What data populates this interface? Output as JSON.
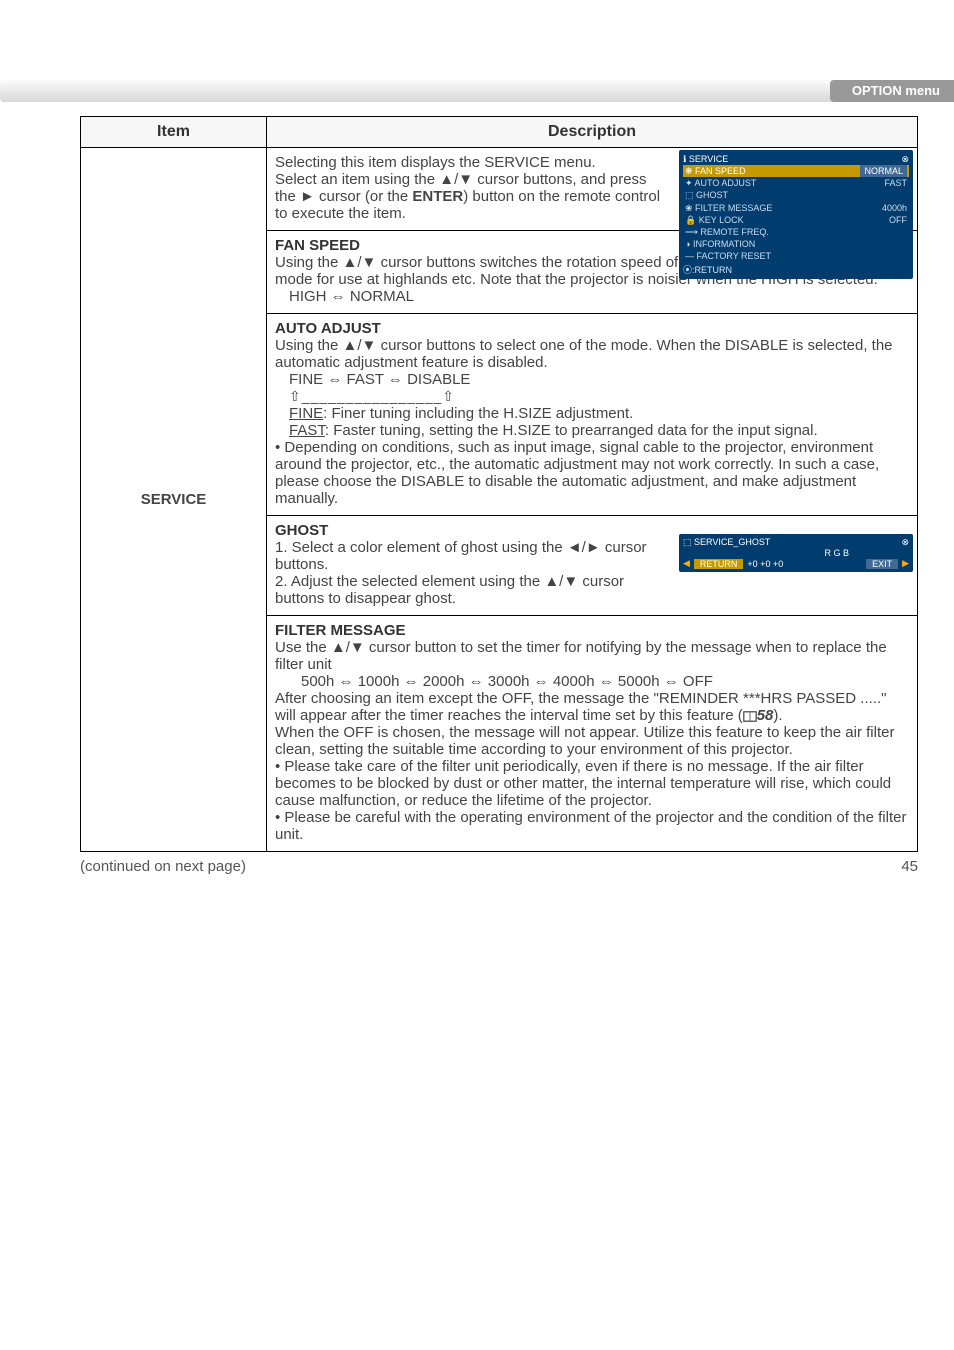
{
  "header": {
    "tab": "OPTION menu"
  },
  "table": {
    "head_item": "Item",
    "head_desc": "Description",
    "item_label": "SERVICE"
  },
  "sec1": {
    "p1": "Selecting this item displays the SERVICE menu.",
    "p2": "Select an item using the ▲/▼ cursor buttons, and press the ► cursor (or the ",
    "p2b": "ENTER",
    "p2c": ") button on the remote control to execute the item."
  },
  "osd": {
    "title": "SERVICE",
    "r1k": "FAN SPEED",
    "r1v": "NORMAL",
    "r2k": "AUTO ADJUST",
    "r2v": "FAST",
    "r3k": "GHOST",
    "r4k": "FILTER MESSAGE",
    "r4v": "4000h",
    "r5k": "KEY LOCK",
    "r5v": "OFF",
    "r6k": "REMOTE FREQ.",
    "r7k": "INFORMATION",
    "r8k": "FACTORY RESET",
    "return": "RETURN"
  },
  "sec2": {
    "h": "FAN SPEED",
    "p1": "Using the ▲/▼ cursor buttons switches the rotation speed of the cooling fans. The HIGH is the mode for use at highlands etc. Note that the projector is noisier when the HIGH is selected.",
    "p2": "HIGH ⇔ NORMAL"
  },
  "sec3": {
    "h": "AUTO ADJUST",
    "p1": "Using the ▲/▼ cursor buttons to select one of the mode. When the DISABLE is selected, the automatic adjustment feature is disabled.",
    "p2": "FINE ⇔ FAST ⇔ DISABLE",
    "arrowline": "⇧________________⇧",
    "fine_l": "FINE",
    "fine_t": ": Finer tuning including the H.SIZE adjustment.",
    "fast_l": "FAST",
    "fast_t": ": Faster tuning, setting the H.SIZE to prearranged data for the input signal.",
    "bullet": "• Depending on conditions, such as input image, signal cable to the projector, environment around the projector, etc., the automatic adjustment may not work correctly.  In such a case, please choose the DISABLE to disable the automatic adjustment, and make adjustment manually."
  },
  "sec4": {
    "h": "GHOST",
    "p1": "1. Select a color element of ghost using the ◄/► cursor buttons.",
    "p2": "2. Adjust the selected element using the ▲/▼ cursor buttons to disappear ghost."
  },
  "osd2": {
    "title": "SERVICE_GHOST",
    "rgb": "R   G   B",
    "return": "RETURN",
    "vals": "+0  +0  +0",
    "exit": "EXIT"
  },
  "sec5": {
    "h": "FILTER MESSAGE",
    "p1": "Use the ▲/▼ cursor button to set the timer for notifying by the message when to replace the filter unit",
    "p2": "500h ⇔ 1000h ⇔ 2000h ⇔ 3000h ⇔ 4000h ⇔ 5000h ⇔ OFF",
    "p3a": "After choosing an item except the OFF, the message the \"REMINDER ***HRS PASSED .....\" will appear after the timer reaches the interval time set by this feature (",
    "p3ref": "58",
    "p3b": ").",
    "p4": "When the OFF is chosen, the message will not appear. Utilize this feature to keep the air filter clean, setting the suitable time according to your environment of this projector.",
    "b1": "• Please take care of the filter unit periodically, even if there is no message. If the air filter becomes to be blocked by dust or other matter, the internal temperature will rise, which could cause malfunction, or reduce the lifetime of the projector.",
    "b2": "• Please be careful with the operating environment of the projector and the condition of the filter unit."
  },
  "footer": {
    "continued": "(continued on next page)",
    "page": "45"
  }
}
